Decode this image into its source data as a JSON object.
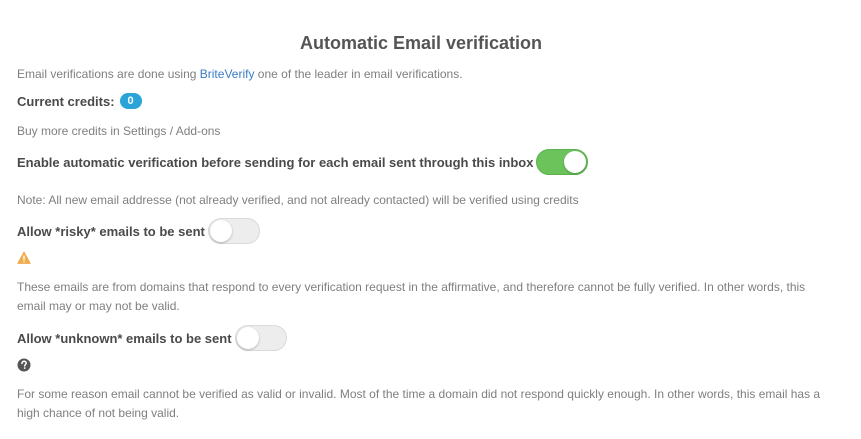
{
  "title": "Automatic Email verification",
  "intro": {
    "prefix": "Email verifications are done using ",
    "link": "BriteVerify",
    "suffix": " one of the leader in email verifications."
  },
  "credits": {
    "label": "Current credits:",
    "value": "0"
  },
  "buy_more": "Buy more credits in Settings / Add-ons",
  "auto_verify": {
    "label": "Enable automatic verification before sending for each email sent through this inbox",
    "enabled": true
  },
  "note": "Note: All new email addresse (not already verified, and not already contacted) will be verified using credits",
  "risky": {
    "label": "Allow *risky* emails to be sent",
    "enabled": false,
    "icon": "warning-icon",
    "description": "These emails are from domains that respond to every verification request in the affirmative, and therefore cannot be fully verified. In other words, this email may or may not be valid."
  },
  "unknown": {
    "label": "Allow *unknown* emails to be sent",
    "enabled": false,
    "icon": "question-circle-icon",
    "description": "For some reason email cannot be verified as valid or invalid. Most of the time a domain did not respond quickly enough. In other words, this email has a high chance of not being valid."
  },
  "colors": {
    "accent_link": "#3a7bc8",
    "badge": "#29a3d8",
    "toggle_on": "#6cc35c",
    "warning": "#f0ad4e",
    "question": "#555555"
  }
}
